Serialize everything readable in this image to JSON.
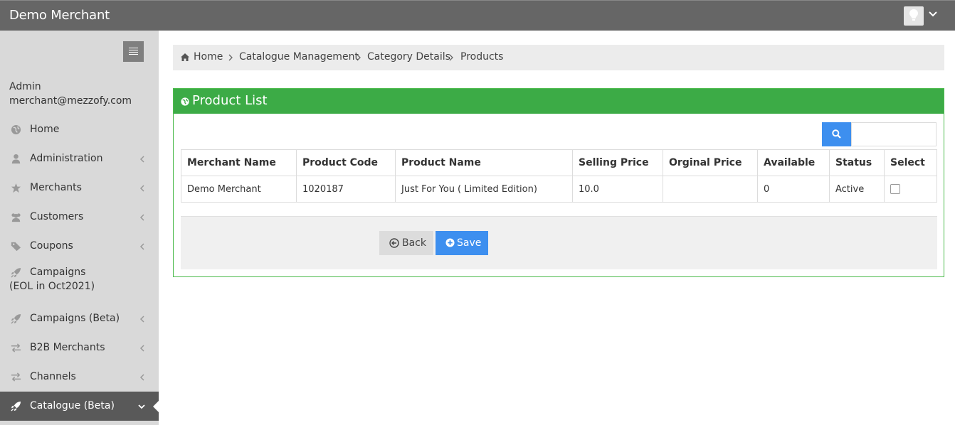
{
  "header": {
    "brand": "Demo Merchant",
    "avatar_icon": "lightbulb-icon",
    "menu_icon": "chevron-down-icon"
  },
  "sidebar": {
    "toggle_icon": "hamburger-icon",
    "user_role": "Admin",
    "user_email": "merchant@mezzofy.com",
    "items": [
      {
        "label": "Home",
        "icon": "globe-icon",
        "has_submenu": false
      },
      {
        "label": "Administration",
        "icon": "user-icon",
        "has_submenu": true
      },
      {
        "label": "Merchants",
        "icon": "star-icon",
        "has_submenu": true
      },
      {
        "label": "Customers",
        "icon": "users-icon",
        "has_submenu": true
      },
      {
        "label": "Coupons",
        "icon": "tag-icon",
        "has_submenu": true
      },
      {
        "label": "Campaigns",
        "label_line2": "(EOL in Oct2021)",
        "icon": "rocket-icon",
        "has_submenu": false
      },
      {
        "label": "Campaigns (Beta)",
        "icon": "rocket-icon",
        "has_submenu": true
      },
      {
        "label": "B2B Merchants",
        "icon": "exchange-icon",
        "has_submenu": true
      },
      {
        "label": "Channels",
        "icon": "exchange-icon",
        "has_submenu": true
      },
      {
        "label": "Catalogue (Beta)",
        "icon": "rocket-icon",
        "has_submenu": true,
        "active": true
      }
    ]
  },
  "breadcrumb": {
    "home_icon": "home-icon",
    "items": [
      "Home",
      "Catalogue Management",
      "Category Details",
      "Products"
    ]
  },
  "panel": {
    "title": "Product List",
    "title_icon": "globe-icon",
    "search": {
      "placeholder": "",
      "value": ""
    },
    "columns": [
      "Merchant Name",
      "Product Code",
      "Product Name",
      "Selling Price",
      "Orginal Price",
      "Available",
      "Status",
      "Select"
    ],
    "rows": [
      {
        "merchant_name": "Demo Merchant",
        "product_code": "1020187",
        "product_name": "Just For You ( Limited Edition)",
        "selling_price": "10.0",
        "original_price": "",
        "available": "0",
        "status": "Active",
        "selected": false
      }
    ],
    "back_label": "Back",
    "save_label": "Save"
  },
  "colors": {
    "topbar": "#666666",
    "sidebar": "#d9d9d9",
    "sidebar_active": "#595959",
    "panel_header": "#3cab46",
    "primary_button": "#3d8fef"
  }
}
